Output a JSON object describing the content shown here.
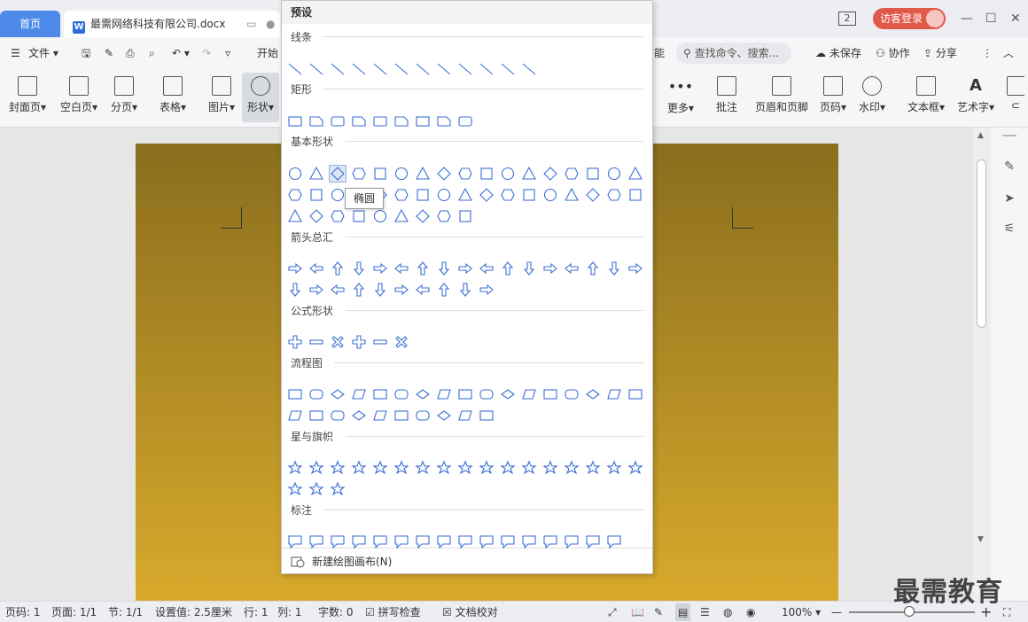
{
  "tabs": {
    "home": "首页",
    "doc": "最需网络科技有限公司.docx"
  },
  "window": {
    "badge": "2",
    "login": "访客登录"
  },
  "toolbar": {
    "file": "文件",
    "start": "开始",
    "partial": "能",
    "search_placeholder": "查找命令、搜索...",
    "unsaved": "未保存",
    "collab": "协作",
    "share": "分享"
  },
  "ribbon": {
    "cover": "封面页",
    "blank": "空白页",
    "pagebreak": "分页",
    "table": "表格",
    "picture": "图片",
    "shape": "形状",
    "more": "更多",
    "comment": "批注",
    "header_footer": "页眉和页脚",
    "page_num": "页码",
    "watermark": "水印",
    "textbox": "文本框",
    "wordart": "艺术字"
  },
  "panel": {
    "title": "预设",
    "sections": [
      "线条",
      "矩形",
      "基本形状",
      "箭头总汇",
      "公式形状",
      "流程图",
      "星与旗帜",
      "标注"
    ],
    "tooltip": "椭圆",
    "footer": "新建绘图画布(N)"
  },
  "status": {
    "page": "页码: 1",
    "pages": "页面: 1/1",
    "section": "节: 1/1",
    "setting": "设置值: 2.5厘米",
    "row": "行: 1",
    "col": "列: 1",
    "words": "字数: 0",
    "spell": "拼写检查",
    "proof": "文档校对",
    "zoom": "100%"
  },
  "watermark_text": "最需教育",
  "colors": {
    "accent": "#4e8be8",
    "shape_stroke": "#3b6fd4",
    "login": "#e05a4a"
  }
}
